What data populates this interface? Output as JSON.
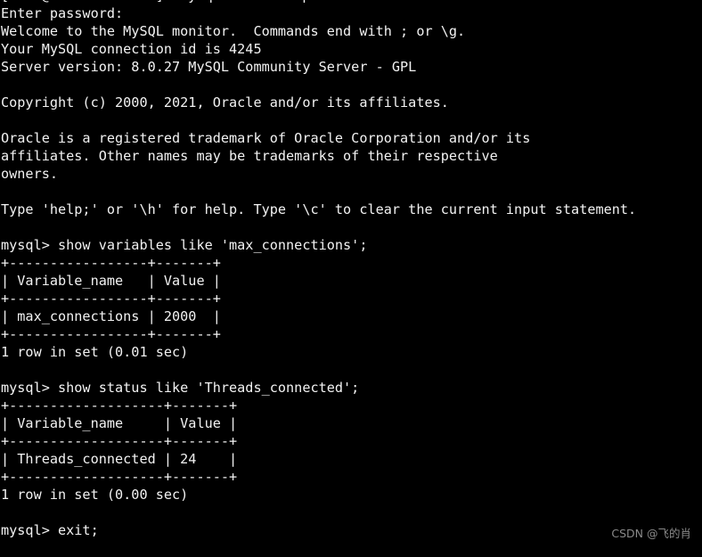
{
  "terminal": {
    "background_color": "#000000",
    "text_color": "#f2f2f2",
    "watermark_color": "#8a8a8a",
    "prompt_shell": "[root@SAPASSIS-DB ~]#",
    "prompt_mysql": "mysql>",
    "lines": [
      "[root@SAPASSIS-DB ~]# mysql -u root -p",
      "Enter password:",
      "Welcome to the MySQL monitor.  Commands end with ; or \\g.",
      "Your MySQL connection id is 4245",
      "Server version: 8.0.27 MySQL Community Server - GPL",
      "",
      "Copyright (c) 2000, 2021, Oracle and/or its affiliates.",
      "",
      "Oracle is a registered trademark of Oracle Corporation and/or its",
      "affiliates. Other names may be trademarks of their respective",
      "owners.",
      "",
      "Type 'help;' or '\\h' for help. Type '\\c' to clear the current input statement.",
      "",
      "mysql> show variables like 'max_connections';",
      "+-----------------+-------+",
      "| Variable_name   | Value |",
      "+-----------------+-------+",
      "| max_connections | 2000  |",
      "+-----------------+-------+",
      "1 row in set (0.01 sec)",
      "",
      "mysql> show status like 'Threads_connected';",
      "+-------------------+-------+",
      "| Variable_name     | Value |",
      "+-------------------+-------+",
      "| Threads_connected | 24    |",
      "+-------------------+-------+",
      "1 row in set (0.00 sec)",
      "",
      "mysql> exit;"
    ],
    "commands": [
      "mysql -u root -p",
      "show variables like 'max_connections';",
      "show status like 'Threads_connected';",
      "exit;"
    ],
    "session_info": {
      "welcome": "Welcome to the MySQL monitor.  Commands end with ; or \\g.",
      "connection_id_label": "Your MySQL connection id is",
      "connection_id": "4245",
      "server_version_label": "Server version:",
      "server_version": "8.0.27",
      "server_edition": "MySQL Community Server - GPL",
      "password_prompt": "Enter password:",
      "copyright": "Copyright (c) 2000, 2021, Oracle and/or its affiliates.",
      "trademark_line_1": "Oracle is a registered trademark of Oracle Corporation and/or its",
      "trademark_line_2": "affiliates. Other names may be trademarks of their respective",
      "trademark_line_3": "owners.",
      "help_hint": "Type 'help;' or '\\h' for help. Type '\\c' to clear the current input statement."
    },
    "results": [
      {
        "query": "show variables like 'max_connections';",
        "columns": [
          "Variable_name",
          "Value"
        ],
        "rows": [
          [
            "max_connections",
            "2000"
          ]
        ],
        "footer": "1 row in set (0.01 sec)"
      },
      {
        "query": "show status like 'Threads_connected';",
        "columns": [
          "Variable_name",
          "Value"
        ],
        "rows": [
          [
            "Threads_connected",
            "24"
          ]
        ],
        "footer": "1 row in set (0.00 sec)"
      }
    ]
  },
  "watermark": {
    "text": "CSDN @飞的肖"
  }
}
